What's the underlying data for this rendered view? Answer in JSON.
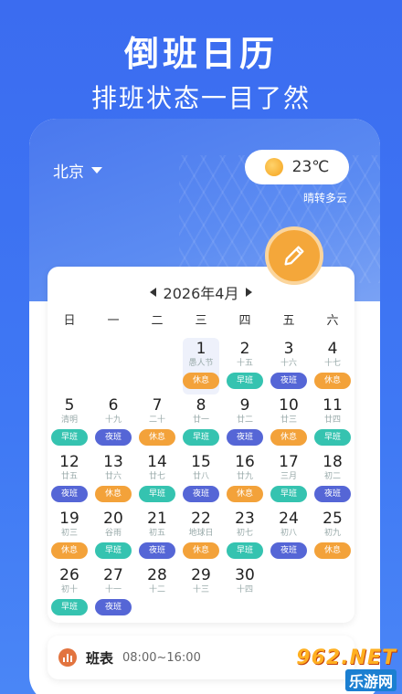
{
  "header": {
    "title": "倒班日历",
    "subtitle": "排班状态一目了然"
  },
  "location": {
    "city": "北京"
  },
  "weather": {
    "temperature": "23℃",
    "description": "晴转多云",
    "icon": "sun-icon"
  },
  "calendar": {
    "month_label": "2026年4月",
    "weekdays": [
      "日",
      "一",
      "二",
      "三",
      "四",
      "五",
      "六"
    ],
    "shift_colors": {
      "休息": "#f3a23a",
      "早班": "#35c3b0",
      "夜班": "#5566d6"
    },
    "leading_blanks": 3,
    "today": 1,
    "days": [
      {
        "d": "1",
        "lunar": "愚人节",
        "shift": "休息"
      },
      {
        "d": "2",
        "lunar": "十五",
        "shift": "早班"
      },
      {
        "d": "3",
        "lunar": "十六",
        "shift": "夜班"
      },
      {
        "d": "4",
        "lunar": "十七",
        "shift": "休息"
      },
      {
        "d": "5",
        "lunar": "清明",
        "shift": "早班"
      },
      {
        "d": "6",
        "lunar": "十九",
        "shift": "夜班"
      },
      {
        "d": "7",
        "lunar": "二十",
        "shift": "休息"
      },
      {
        "d": "8",
        "lunar": "廿一",
        "shift": "早班"
      },
      {
        "d": "9",
        "lunar": "廿二",
        "shift": "夜班"
      },
      {
        "d": "10",
        "lunar": "廿三",
        "shift": "休息"
      },
      {
        "d": "11",
        "lunar": "廿四",
        "shift": "早班"
      },
      {
        "d": "12",
        "lunar": "廿五",
        "shift": "夜班"
      },
      {
        "d": "13",
        "lunar": "廿六",
        "shift": "休息"
      },
      {
        "d": "14",
        "lunar": "廿七",
        "shift": "早班"
      },
      {
        "d": "15",
        "lunar": "廿八",
        "shift": "夜班"
      },
      {
        "d": "16",
        "lunar": "廿九",
        "shift": "休息"
      },
      {
        "d": "17",
        "lunar": "三月",
        "shift": "早班"
      },
      {
        "d": "18",
        "lunar": "初二",
        "shift": "夜班"
      },
      {
        "d": "19",
        "lunar": "初三",
        "shift": "休息"
      },
      {
        "d": "20",
        "lunar": "谷雨",
        "shift": "早班"
      },
      {
        "d": "21",
        "lunar": "初五",
        "shift": "夜班"
      },
      {
        "d": "22",
        "lunar": "地球日",
        "shift": "休息"
      },
      {
        "d": "23",
        "lunar": "初七",
        "shift": "早班"
      },
      {
        "d": "24",
        "lunar": "初八",
        "shift": "夜班"
      },
      {
        "d": "25",
        "lunar": "初九",
        "shift": "休息"
      },
      {
        "d": "26",
        "lunar": "初十",
        "shift": "早班"
      },
      {
        "d": "27",
        "lunar": "十一",
        "shift": "夜班"
      },
      {
        "d": "28",
        "lunar": "十二",
        "shift": ""
      },
      {
        "d": "29",
        "lunar": "十三",
        "shift": ""
      },
      {
        "d": "30",
        "lunar": "十四",
        "shift": ""
      }
    ]
  },
  "schedule": {
    "label": "班表",
    "time": "08:00~16:00"
  },
  "watermark": {
    "top": "962.NET",
    "bottom": "乐游网"
  }
}
